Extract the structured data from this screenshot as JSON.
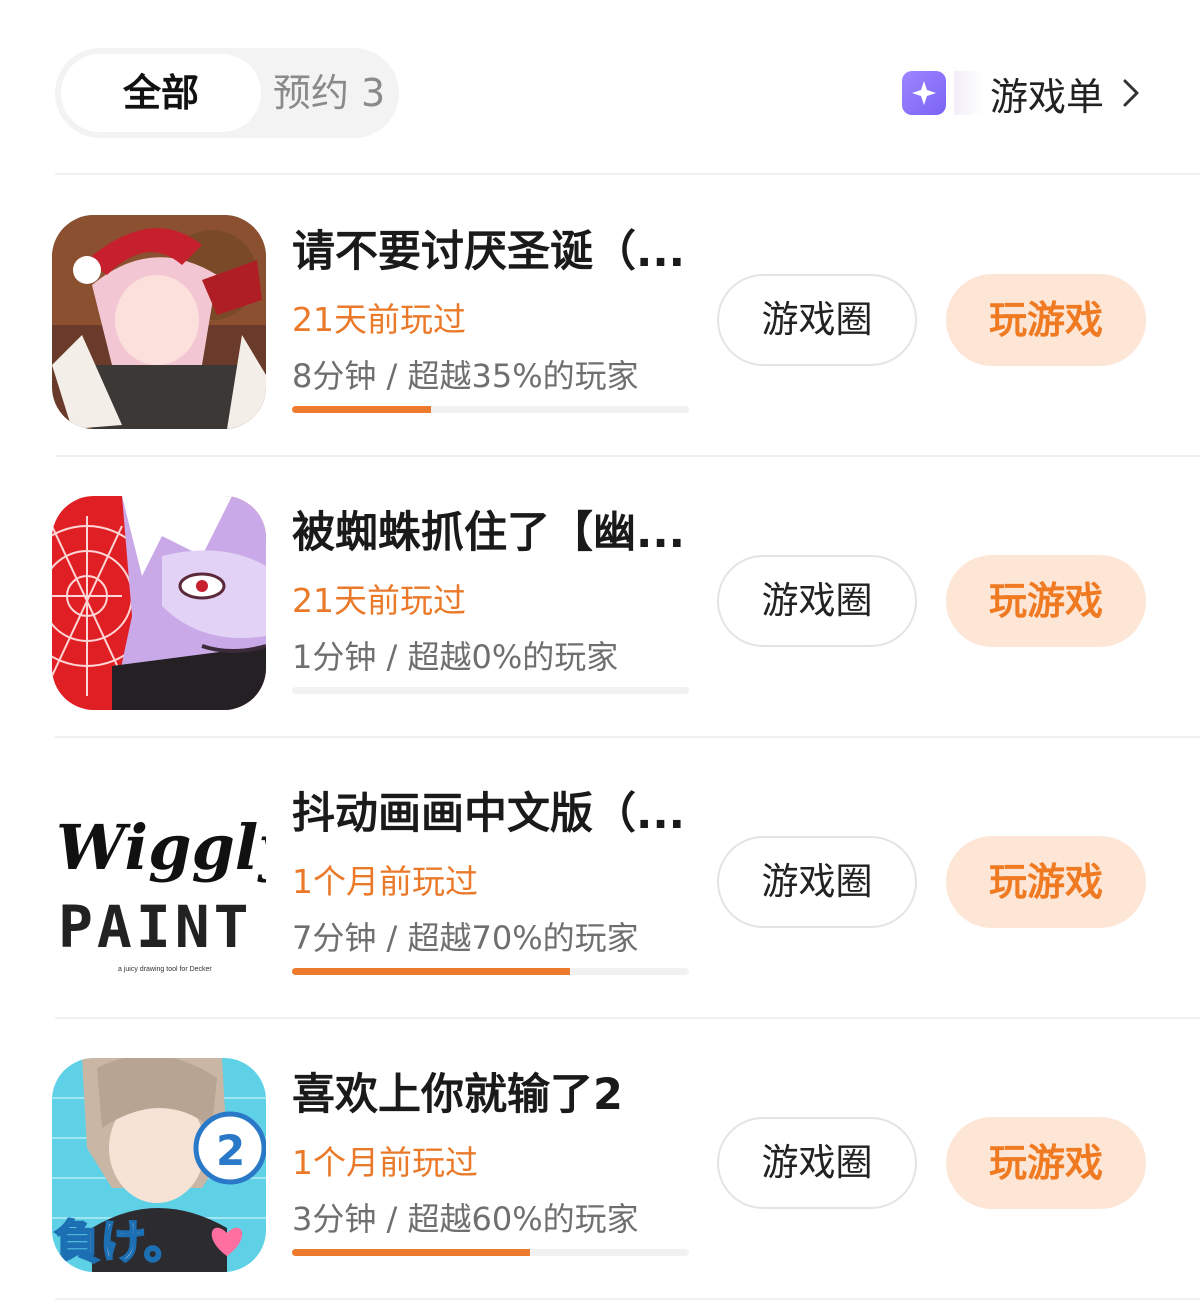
{
  "tabs": {
    "all_label": "全部",
    "reserved_label": "预约 3"
  },
  "gamelist": {
    "label": "游戏单"
  },
  "games": [
    {
      "title": "请不要讨厌圣诞（...",
      "played": "21天前玩过",
      "stats": "8分钟 / 超越35%的玩家",
      "progress": 0.35,
      "circle_label": "游戏圈",
      "play_label": "玩游戏",
      "icon": "santa-anime-icon"
    },
    {
      "title": "被蜘蛛抓住了【幽...",
      "played": "21天前玩过",
      "stats": "1分钟 / 超越0%的玩家",
      "progress": 0.0,
      "circle_label": "游戏圈",
      "play_label": "玩游戏",
      "icon": "spider-anime-icon"
    },
    {
      "title": "抖动画画中文版（...",
      "played": "1个月前玩过",
      "stats": "7分钟 / 超越70%的玩家",
      "progress": 0.7,
      "circle_label": "游戏圈",
      "play_label": "玩游戏",
      "icon": "wiggly-paint-icon",
      "icon_text": [
        "Wiggly",
        "PAINT",
        "a juicy drawing tool for Decker"
      ]
    },
    {
      "title": "喜欢上你就输了2",
      "played": "1个月前玩过",
      "stats": "3分钟 / 超越60%的玩家",
      "progress": 0.6,
      "circle_label": "游戏圈",
      "play_label": "玩游戏",
      "icon": "anime-boy-icon",
      "icon_text": [
        "2",
        "負け。"
      ]
    }
  ],
  "colors": {
    "accent": "#ee7a2d",
    "play_bg": "#fde6d6",
    "icon_purple": "#8b73f8"
  }
}
